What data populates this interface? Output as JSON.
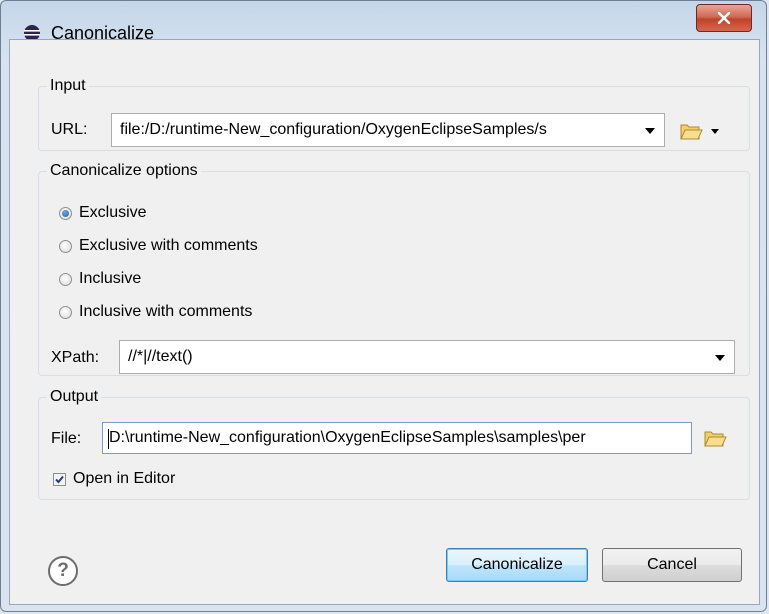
{
  "window": {
    "title": "Canonicalize",
    "close_label": "X"
  },
  "input_group": {
    "legend": "Input",
    "url_label": "URL:",
    "url_value": "file:/D:/runtime-New_configuration/OxygenEclipseSamples/s"
  },
  "options_group": {
    "legend": "Canonicalize options",
    "radios": [
      {
        "label": "Exclusive",
        "checked": true
      },
      {
        "label": "Exclusive with comments",
        "checked": false
      },
      {
        "label": "Inclusive",
        "checked": false
      },
      {
        "label": "Inclusive with comments",
        "checked": false
      }
    ],
    "xpath_label": "XPath:",
    "xpath_value": "//*|//text()"
  },
  "output_group": {
    "legend": "Output",
    "file_label": "File:",
    "file_value": "D:\\runtime-New_configuration\\OxygenEclipseSamples\\samples\\per",
    "open_in_editor_label": "Open in Editor",
    "open_in_editor_checked": true
  },
  "footer": {
    "help_glyph": "?",
    "canonicalize_label": "Canonicalize",
    "cancel_label": "Cancel"
  },
  "icons": {
    "title_icon": "eclipse-icon",
    "browse_icon": "folder-open-icon",
    "help_icon": "help-icon"
  },
  "colors": {
    "accent": "#3c7fb1",
    "close": "#c0432a",
    "folder": "#e8b84a"
  }
}
